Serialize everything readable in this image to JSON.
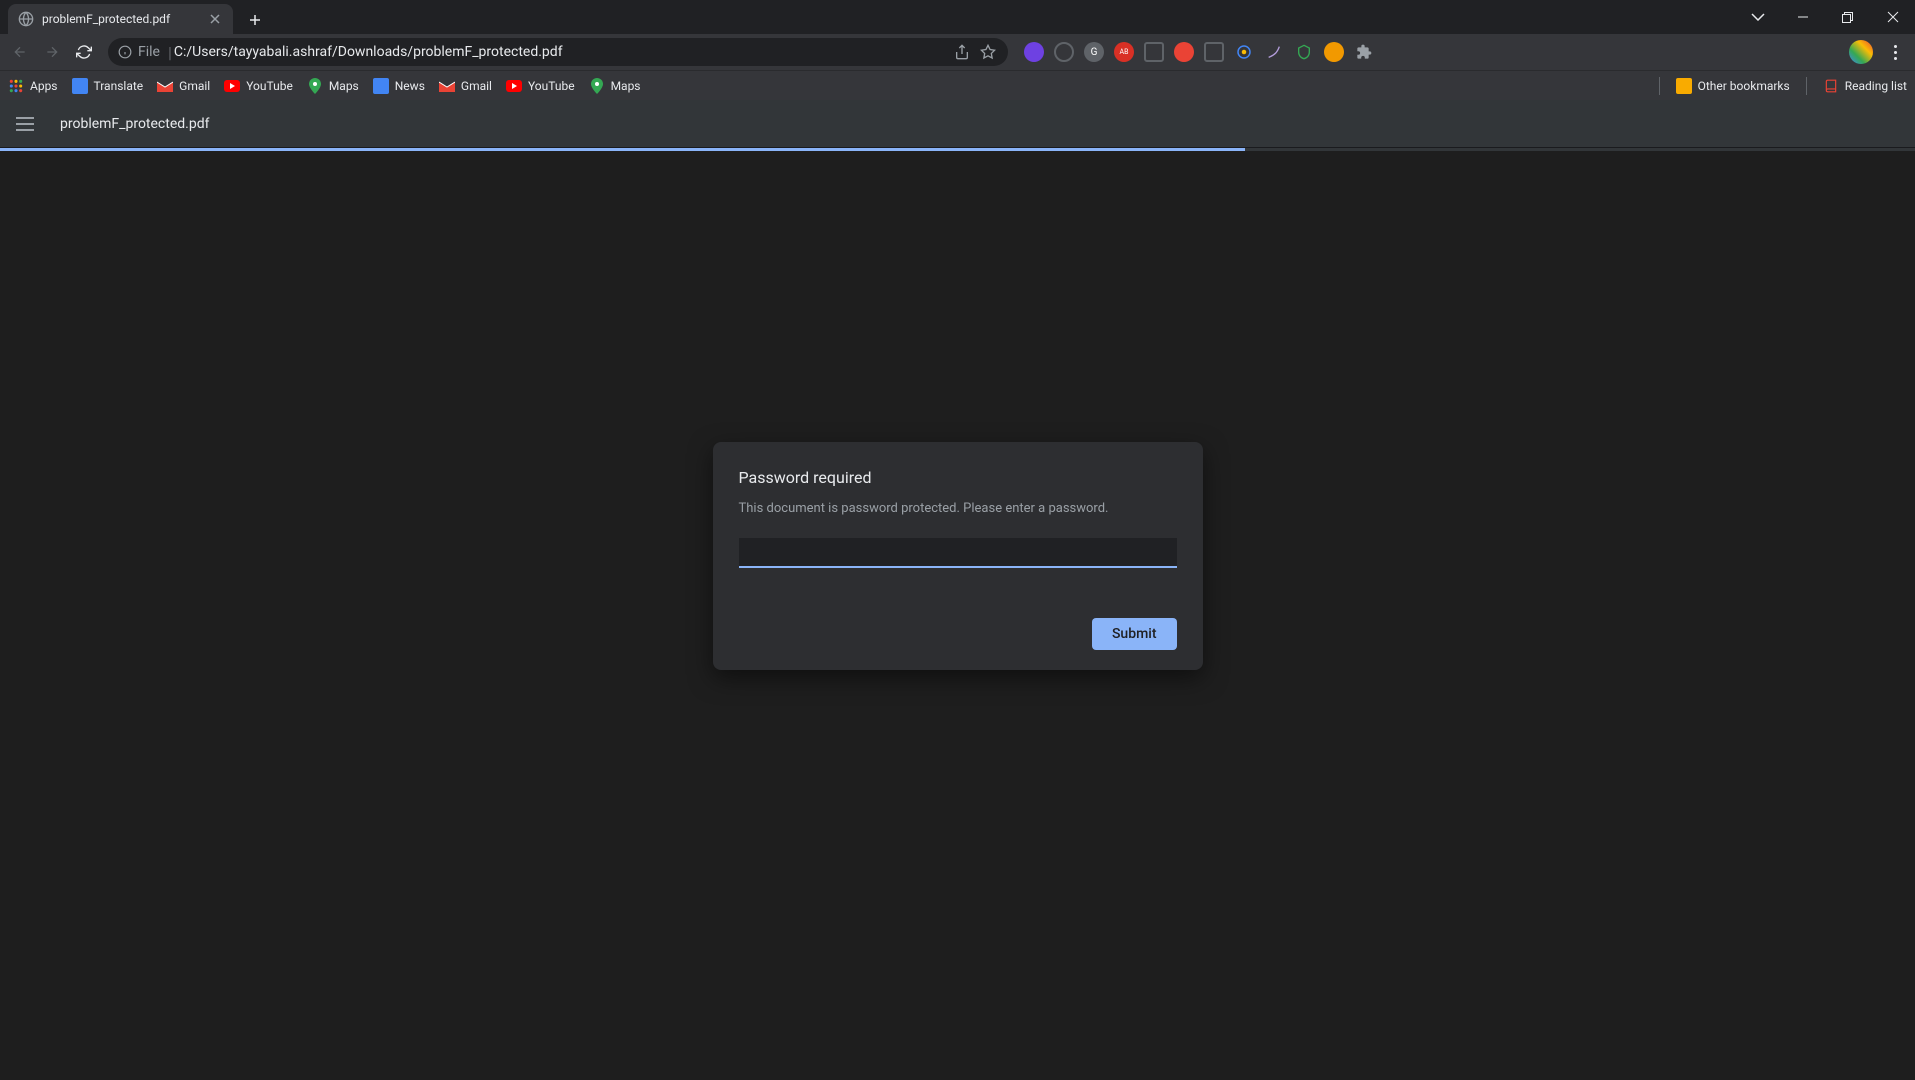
{
  "tab": {
    "title": "problemF_protected.pdf"
  },
  "address": {
    "prefix": "File",
    "path": "C:/Users/tayyabali.ashraf/Downloads/problemF_protected.pdf"
  },
  "bookmarks": {
    "items": [
      {
        "label": "Apps"
      },
      {
        "label": "Translate"
      },
      {
        "label": "Gmail"
      },
      {
        "label": "YouTube"
      },
      {
        "label": "Maps"
      },
      {
        "label": "News"
      },
      {
        "label": "Gmail"
      },
      {
        "label": "YouTube"
      },
      {
        "label": "Maps"
      }
    ],
    "other": "Other bookmarks",
    "reading": "Reading list"
  },
  "pdf": {
    "filename": "problemF_protected.pdf"
  },
  "dialog": {
    "title": "Password required",
    "message": "This document is password protected. Please enter a password.",
    "submit": "Submit",
    "input_value": ""
  }
}
